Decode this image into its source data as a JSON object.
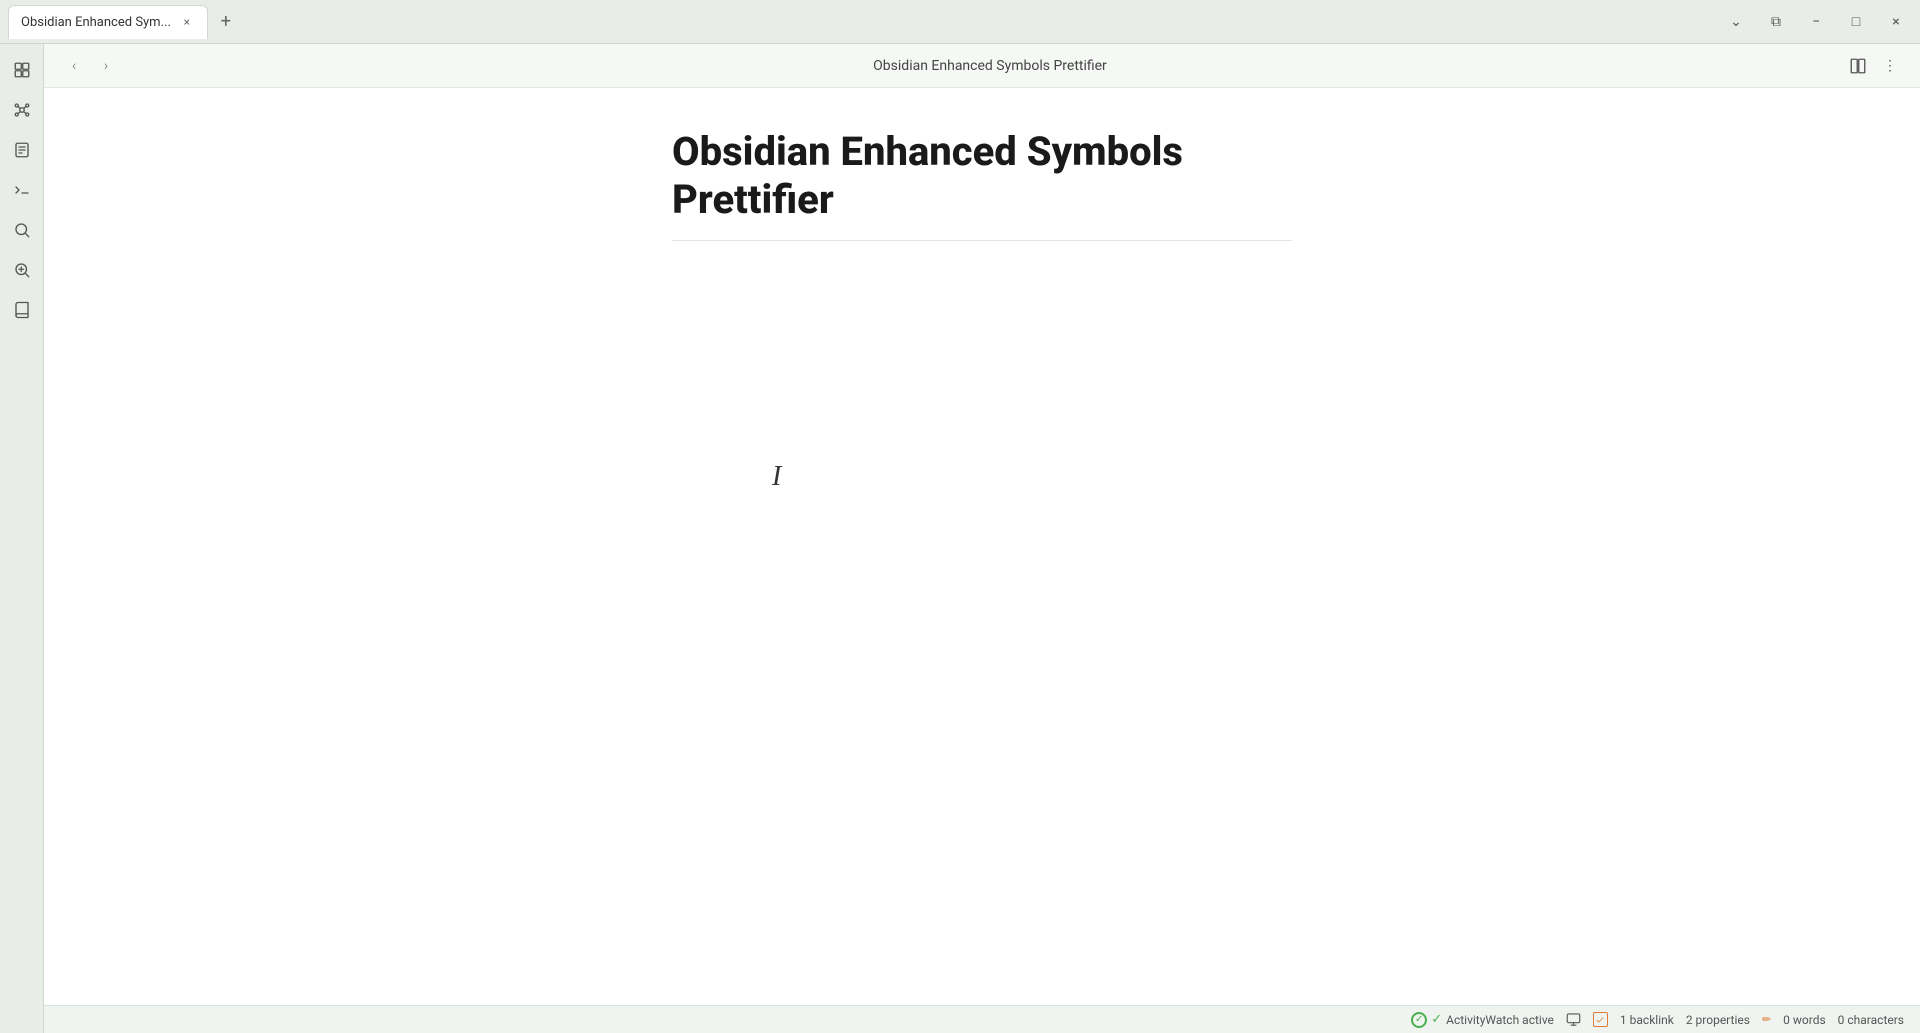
{
  "titlebar": {
    "tab_label": "Obsidian Enhanced Sym...",
    "tab_close_symbol": "×",
    "tab_new_symbol": "+",
    "dropdown_symbol": "⌄",
    "split_symbol": "⧉",
    "minimize_symbol": "−",
    "maximize_symbol": "□",
    "close_symbol": "×"
  },
  "sidebar": {
    "icons": [
      {
        "name": "files-icon",
        "symbol": "⊞",
        "label": "Files"
      },
      {
        "name": "graph-icon",
        "symbol": "⊙",
        "label": "Graph"
      },
      {
        "name": "pages-icon",
        "symbol": "⊟",
        "label": "Pages"
      },
      {
        "name": "terminal-icon",
        "symbol": ">_",
        "label": "Terminal"
      },
      {
        "name": "search2-icon",
        "symbol": "⊕",
        "label": "Search"
      },
      {
        "name": "search-icon",
        "symbol": "🔍",
        "label": "Search"
      },
      {
        "name": "book-icon",
        "symbol": "📖",
        "label": "Book"
      }
    ]
  },
  "toolbar": {
    "back_label": "‹",
    "forward_label": "›",
    "title": "Obsidian Enhanced Symbols Prettifier",
    "book_view_symbol": "⧉",
    "more_symbol": "⋮"
  },
  "editor": {
    "heading": "Obsidian Enhanced Symbols Prettifier",
    "cursor_symbol": "I"
  },
  "statusbar": {
    "activitywatch_label": "ActivityWatch active",
    "backlink_label": "1 backlink",
    "properties_label": "2 properties",
    "words_label": "0 words",
    "chars_label": "0 characters"
  }
}
